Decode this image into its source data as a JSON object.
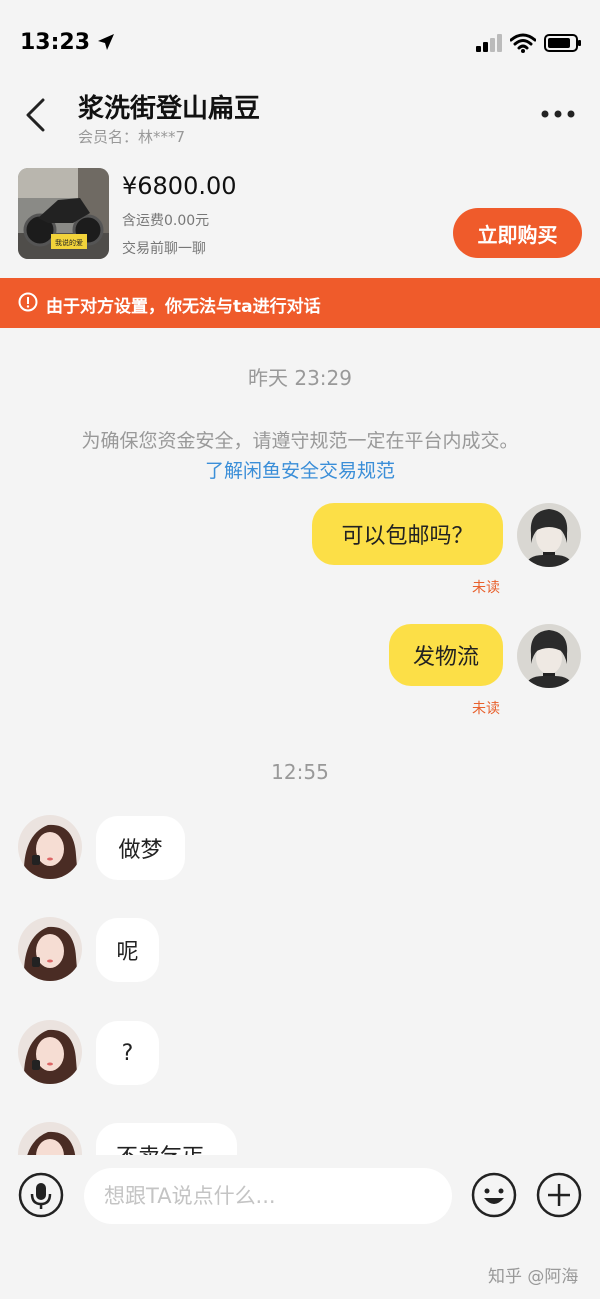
{
  "status_bar": {
    "time": "13:23"
  },
  "header": {
    "title": "浆洗街登山扁豆",
    "subtitle": "会员名：林***7"
  },
  "product": {
    "price": "¥6800.00",
    "shipping": "含运费0.00元",
    "note": "交易前聊一聊",
    "buy_label": "立即购买",
    "image_label": "我说的爱"
  },
  "banner": {
    "text": "由于对方设置，你无法与ta进行对话"
  },
  "messages": {
    "timestamp1": "昨天 23:29",
    "notice": "为确保您资金安全，请遵守规范一定在平台内成交。",
    "rule_link": "了解闲鱼安全交易规范",
    "mine": [
      {
        "text": "可以包邮吗？",
        "status": "未读"
      },
      {
        "text": "发物流",
        "status": "未读"
      }
    ],
    "timestamp2": "12:55",
    "theirs": [
      {
        "text": "做梦"
      },
      {
        "text": "呢"
      },
      {
        "text": "?"
      },
      {
        "text": "不卖乞丐"
      }
    ]
  },
  "input": {
    "placeholder": "想跟TA说点什么..."
  },
  "watermark": "知乎 @阿海",
  "colors": {
    "accent": "#ef5b2b",
    "my_bubble": "#fcdf47",
    "link": "#3a8ed8",
    "unread": "#e8602c"
  },
  "icons": [
    "location-arrow-icon",
    "signal-icon",
    "wifi-icon",
    "battery-icon",
    "back-chevron-icon",
    "more-dots-icon",
    "warning-circle-icon",
    "microphone-icon",
    "emoji-icon",
    "plus-icon"
  ]
}
